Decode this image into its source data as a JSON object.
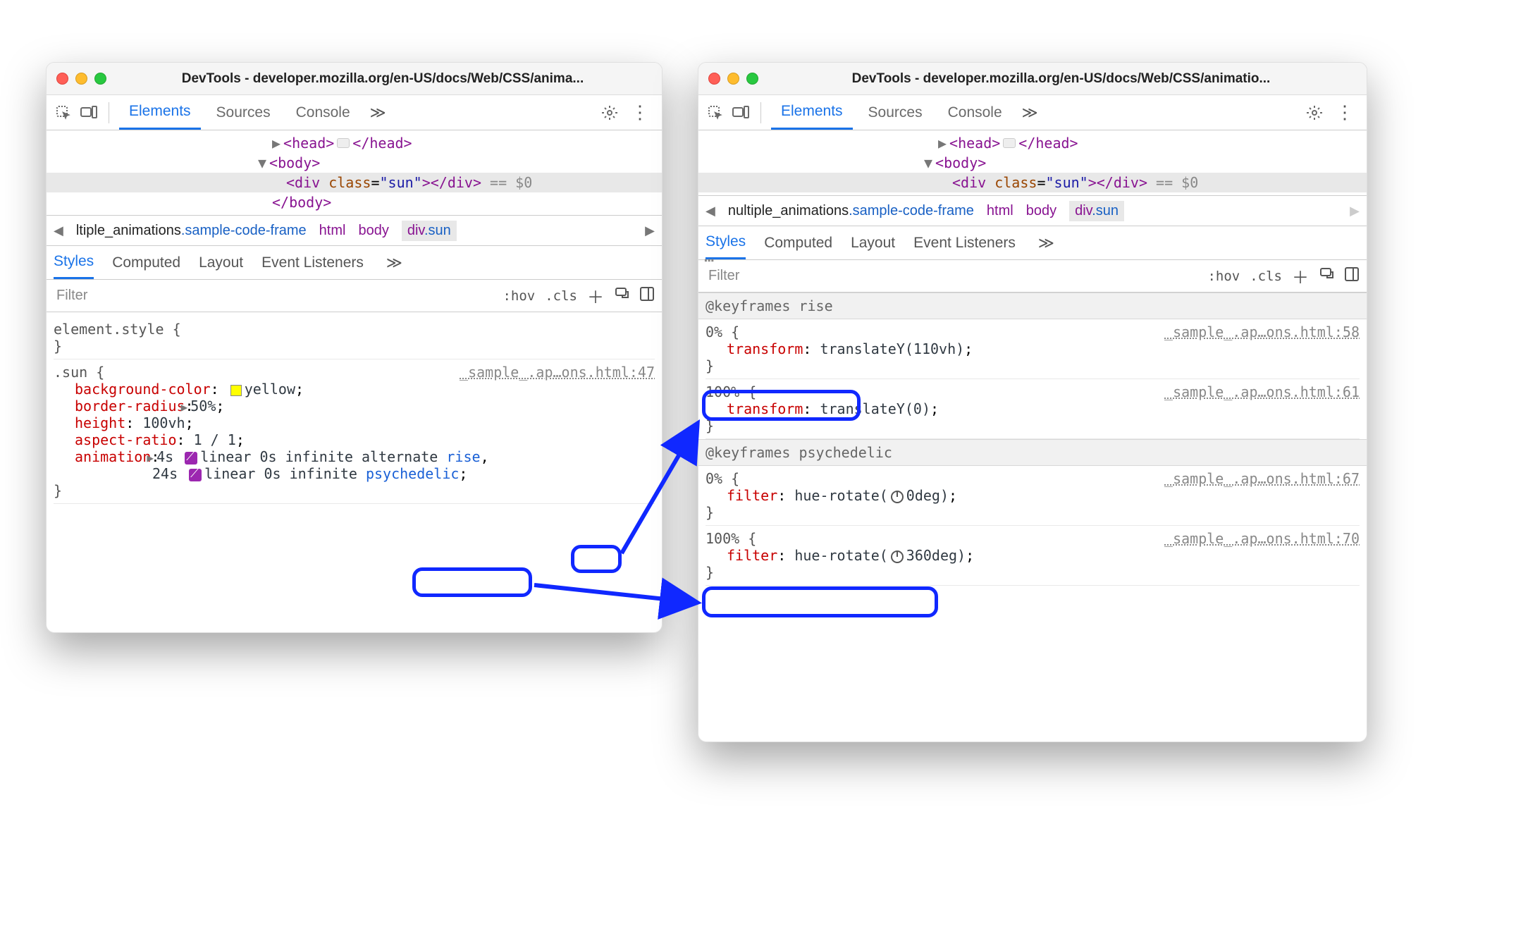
{
  "title": "DevTools - developer.mozilla.org/en-US/docs/Web/CSS/anima...",
  "title_right": "DevTools - developer.mozilla.org/en-US/docs/Web/CSS/animatio...",
  "tabs": {
    "elements": "Elements",
    "sources": "Sources",
    "console": "Console"
  },
  "dom": {
    "head_open": "<head>",
    "head_close": "</head>",
    "body_open": "<body>",
    "body_close": "</body>",
    "div_open1": "<div ",
    "div_attr_name": "class",
    "div_attr_val": "\"sun\"",
    "div_close1": ">",
    "div_close2": "</div>",
    "after": " == $0"
  },
  "crumb": {
    "left": "ltiple_animations",
    "left_right": "nultiple_animations",
    "sample": ".sample-code-frame",
    "html": "html",
    "body": "body",
    "divsun": "div",
    "sun": ".sun"
  },
  "subtabs": {
    "styles": "Styles",
    "computed": "Computed",
    "layout": "Layout",
    "events": "Event Listeners"
  },
  "filter": {
    "placeholder": "Filter",
    "hov": ":hov",
    "cls": ".cls"
  },
  "left_styles": {
    "element_style": "element.style {",
    "close": "}",
    "sun_selector": ".sun {",
    "sun_source": "_sample_.ap…ons.html:47",
    "bg": {
      "name": "background-color",
      "val": "yellow"
    },
    "br": {
      "name": "border-radius",
      "val": "50%"
    },
    "h": {
      "name": "height",
      "val": "100vh"
    },
    "ar": {
      "name": "aspect-ratio",
      "val": "1 / 1"
    },
    "anim_name": "animation",
    "anim_line1a": "4s ",
    "anim_line1b": "linear 0s infinite alternate ",
    "anim_rise": "rise",
    "anim_line2a": "24s ",
    "anim_line2b": "linear 0s infinite ",
    "anim_psych": "psychedelic"
  },
  "right_styles": {
    "kf_rise": "@keyframes rise",
    "kf_psych": "@keyframes psychedelic",
    "p0": "0% {",
    "p100": "100% {",
    "src58": "_sample_.ap…ons.html:58",
    "src61": "_sample_.ap…ons.html:61",
    "src67": "_sample_.ap…ons.html:67",
    "src70": "_sample_.ap…ons.html:70",
    "tf": "transform",
    "tf_v1": "translateY(110vh)",
    "tf_v2": "translateY(0)",
    "fl": "filter",
    "fl_v1": "hue-rotate(",
    "fl_d1": "0deg)",
    "fl_d2": "360deg)"
  }
}
